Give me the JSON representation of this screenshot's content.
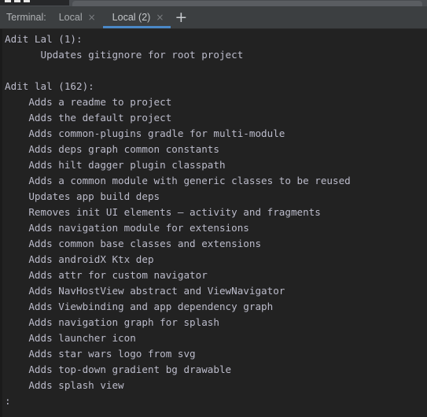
{
  "window": {
    "top_strip": {
      "dots_icon": "window-dots-icon",
      "dot_count": 3
    }
  },
  "tabbar": {
    "label": "Terminal:",
    "new_tab_label": "+",
    "close_glyph": "×",
    "active_underline_color": "#4a88c7",
    "background_color": "#3c3f41",
    "tabs": [
      {
        "title": "Local",
        "active": false
      },
      {
        "title": "Local (2)",
        "active": true
      }
    ]
  },
  "terminal": {
    "background_color": "#222222",
    "text_color": "#bcbccb",
    "lines": [
      "Adit Lal (1):",
      "      Updates gitignore for root project",
      "",
      "Adit lal (162):",
      "    Adds a readme to project",
      "    Adds the default project",
      "    Adds common-plugins gradle for multi-module",
      "    Adds deps graph common constants",
      "    Adds hilt dagger plugin classpath",
      "    Adds a common module with generic classes to be reused",
      "    Updates app build deps",
      "    Removes init UI elements – activity and fragments",
      "    Adds navigation module for extensions",
      "    Adds common base classes and extensions",
      "    Adds androidX Ktx dep",
      "    Adds attr for custom navigator",
      "    Adds NavHostView abstract and ViewNavigator",
      "    Adds Viewbinding and app dependency graph",
      "    Adds navigation graph for splash",
      "    Adds launcher icon",
      "    Adds star wars logo from svg",
      "    Adds top-down gradient bg drawable",
      "    Adds splash view",
      ":"
    ]
  }
}
